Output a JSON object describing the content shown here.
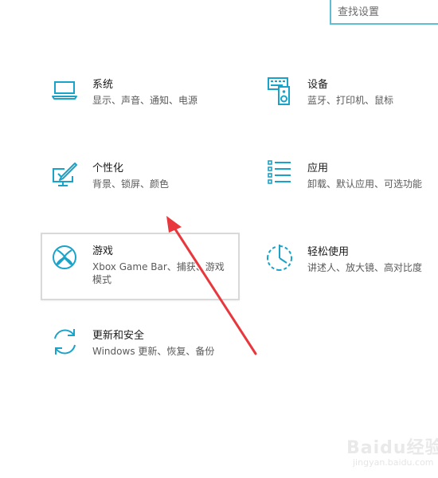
{
  "search": {
    "placeholder": "查找设置"
  },
  "tiles": [
    {
      "key": "system",
      "title": "系统",
      "desc": "显示、声音、通知、电源",
      "icon": "laptop-icon"
    },
    {
      "key": "devices",
      "title": "设备",
      "desc": "蓝牙、打印机、鼠标",
      "icon": "keyboard-speaker-icon"
    },
    {
      "key": "personalization",
      "title": "个性化",
      "desc": "背景、锁屏、颜色",
      "icon": "paintbrush-monitor-icon"
    },
    {
      "key": "apps",
      "title": "应用",
      "desc": "卸载、默认应用、可选功能",
      "icon": "list-icon"
    },
    {
      "key": "gaming",
      "title": "游戏",
      "desc": "Xbox Game Bar、捕获、游戏模式",
      "icon": "xbox-icon"
    },
    {
      "key": "ease_of_access",
      "title": "轻松使用",
      "desc": "讲述人、放大镜、高对比度",
      "icon": "ease-of-access-icon"
    },
    {
      "key": "update_security",
      "title": "更新和安全",
      "desc": "Windows 更新、恢复、备份",
      "icon": "sync-arrows-icon"
    }
  ],
  "annotation": {
    "color": "#e8383d"
  },
  "watermark": {
    "line1": "Baidu经验",
    "line2": "jingyan.baidu.com"
  },
  "colors": {
    "accent": "#1aa3c8",
    "search_border": "#5fbdd6",
    "tile_border": "#d9d9d9"
  }
}
